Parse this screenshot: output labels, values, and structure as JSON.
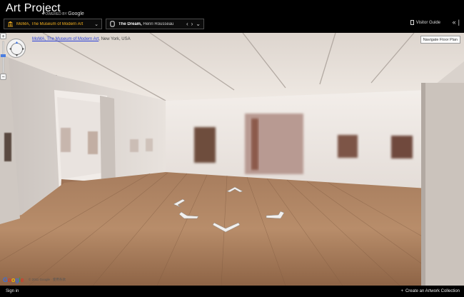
{
  "header": {
    "brand": "Art Project",
    "powered_prefix": "POWERED BY",
    "powered_brand": "Google",
    "museum_selector": "MoMA, The Museum of Modern Art",
    "artwork_title": "The Dream,",
    "artwork_artist": "Henri Rousseau",
    "visitor_guide": "Visitor Guide"
  },
  "view": {
    "museum_link": "MoMA, The Museum of Modern Art",
    "museum_location": ", New York, USA",
    "floor_plan_button": "Navigate Floor Plan",
    "copyright": "© 2011 Google · 使用条款"
  },
  "footer": {
    "sign_in": "Sign in",
    "create_collection": "Create an Artwork Collection"
  },
  "colors": {
    "accent_yellow": "#f6b11f",
    "link_blue": "#2a3fd8",
    "header_bg": "#000000"
  }
}
